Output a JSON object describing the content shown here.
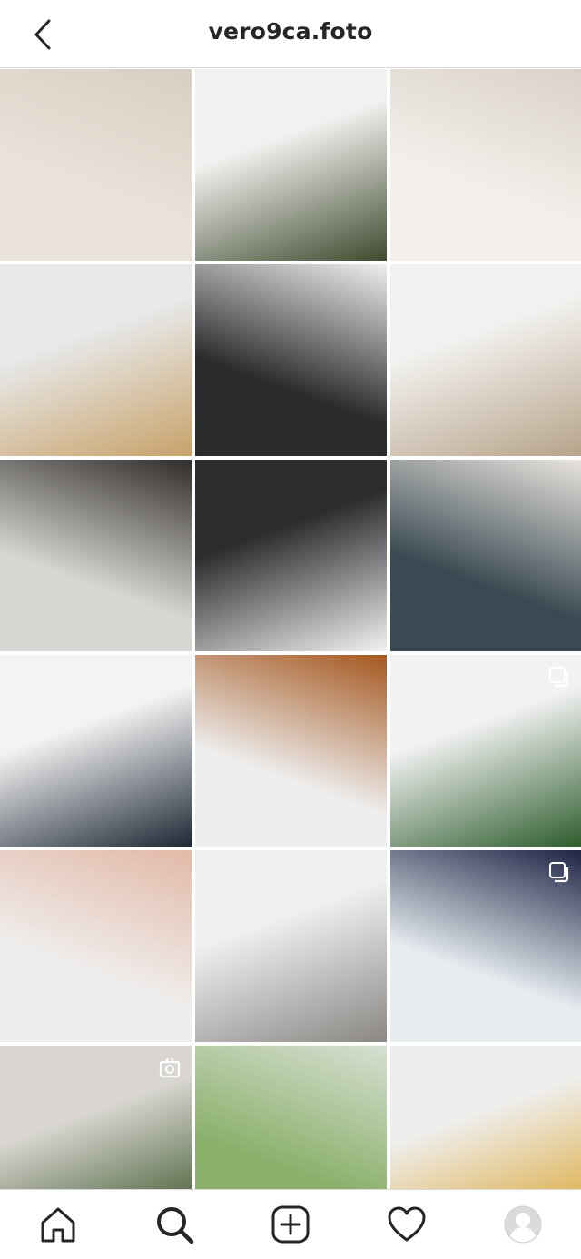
{
  "header": {
    "title": "vero9ca.foto",
    "back_icon": "chevron-left-icon"
  },
  "posts": [
    {
      "name": "post-waffle-avocado",
      "colors": [
        "#e9e3da",
        "#d8cfc2"
      ]
    },
    {
      "name": "post-plant-egg-pot",
      "colors": [
        "#f1f1ef",
        "#3f4a2e"
      ]
    },
    {
      "name": "post-child-teddy",
      "colors": [
        "#f3f0ec",
        "#d9d2c8"
      ]
    },
    {
      "name": "post-pancake-stack",
      "colors": [
        "#e8e9ea",
        "#c8a26a"
      ]
    },
    {
      "name": "post-black-kitchen",
      "colors": [
        "#2a2b2d",
        "#efefef"
      ]
    },
    {
      "name": "post-mirror-console",
      "colors": [
        "#f2f1ef",
        "#b7a48a"
      ]
    },
    {
      "name": "post-candles-snacks",
      "colors": [
        "#d8d6d3",
        "#2f2c2a"
      ]
    },
    {
      "name": "post-kitchen-island",
      "colors": [
        "#2c2d2f",
        "#f2f2f2"
      ]
    },
    {
      "name": "post-laptop-planner",
      "colors": [
        "#3a4a52",
        "#e9e4de"
      ]
    },
    {
      "name": "post-black-cabinet",
      "colors": [
        "#f3f3f3",
        "#1f2835"
      ]
    },
    {
      "name": "post-candles-cinnamon-buns",
      "colors": [
        "#eeeeee",
        "#a4571f"
      ]
    },
    {
      "name": "post-wall-art-monstera",
      "colors": [
        "#f2f2f2",
        "#2e5d2e"
      ],
      "icon": "multiple-photos-icon"
    },
    {
      "name": "post-child-reading",
      "colors": [
        "#efeeed",
        "#e3b9a7"
      ]
    },
    {
      "name": "post-tabby-cat",
      "colors": [
        "#efefef",
        "#8a8784"
      ]
    },
    {
      "name": "post-woman-outdoors",
      "colors": [
        "#e6ecef",
        "#1e2546"
      ],
      "icon": "multiple-photos-icon"
    },
    {
      "name": "post-plant-latte",
      "colors": [
        "#d9d6d1",
        "#2f4b1d"
      ],
      "icon": "igtv-icon"
    },
    {
      "name": "post-mother-daughter",
      "colors": [
        "#8ab06a",
        "#d7e0d3"
      ]
    },
    {
      "name": "post-roses-dining",
      "colors": [
        "#efeeec",
        "#d9a22a"
      ]
    },
    {
      "name": "post-partial-1",
      "colors": [
        "#cfcfcf",
        "#9a9a9a"
      ]
    },
    {
      "name": "post-partial-2",
      "colors": [
        "#bdbdbd",
        "#7a7a7a"
      ]
    },
    {
      "name": "post-partial-3",
      "colors": [
        "#e2dfda",
        "#bdb6ad"
      ]
    }
  ],
  "bottom_nav": [
    {
      "name": "nav-home",
      "icon": "home-icon"
    },
    {
      "name": "nav-search",
      "icon": "search-icon",
      "active": true
    },
    {
      "name": "nav-new-post",
      "icon": "add-post-icon"
    },
    {
      "name": "nav-activity",
      "icon": "heart-icon"
    },
    {
      "name": "nav-profile",
      "icon": "profile-avatar-icon"
    }
  ]
}
